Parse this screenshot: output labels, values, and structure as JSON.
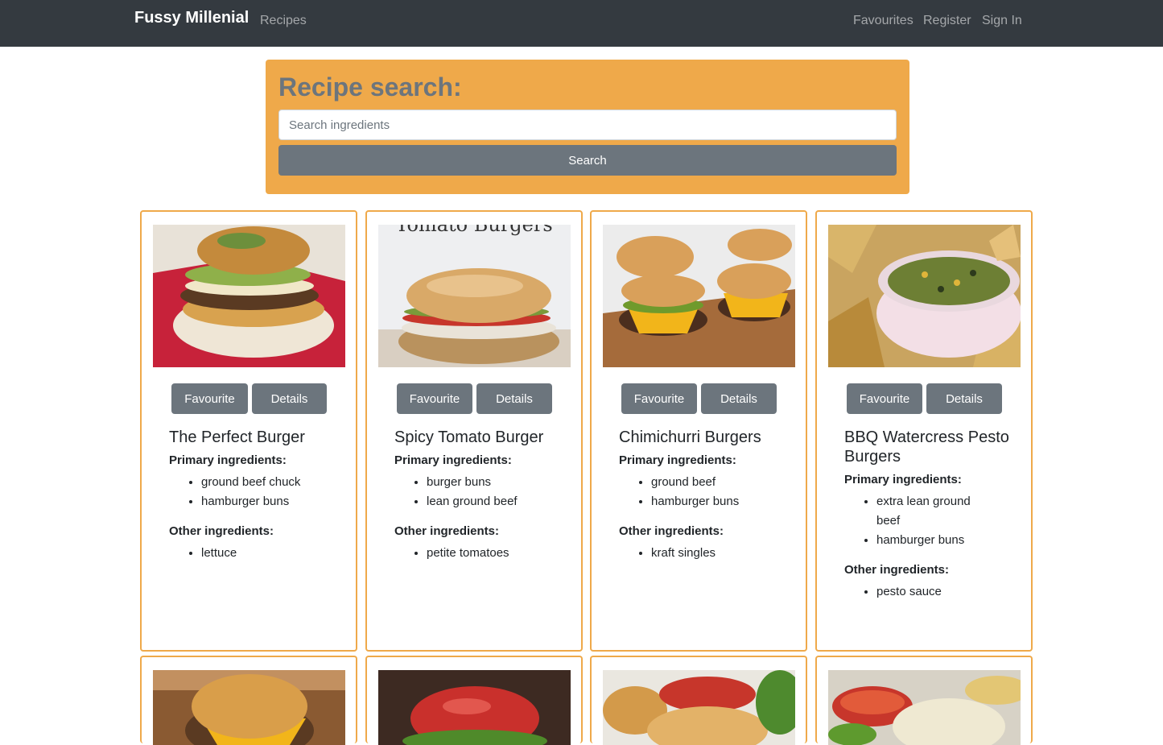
{
  "navbar": {
    "brand": "Fussy Millenial",
    "links_left": [
      "Recipes"
    ],
    "links_right": [
      "Favourites",
      "Register",
      "Sign In"
    ]
  },
  "search": {
    "title": "Recipe search:",
    "placeholder": "Search ingredients",
    "button_label": "Search"
  },
  "card_buttons": {
    "favourite": "Favourite",
    "details": "Details"
  },
  "labels": {
    "primary": "Primary ingredients:",
    "other": "Other ingredients:"
  },
  "recipes": [
    {
      "title": "The Perfect Burger",
      "primary": [
        "ground beef chuck",
        "hamburger buns"
      ],
      "other": [
        "lettuce"
      ]
    },
    {
      "title": "Spicy Tomato Burger",
      "image_caption": "Tomato Burgers",
      "primary": [
        "burger buns",
        "lean ground beef"
      ],
      "other": [
        "petite tomatoes"
      ]
    },
    {
      "title": "Chimichurri Burgers",
      "primary": [
        "ground beef",
        "hamburger buns"
      ],
      "other": [
        "kraft singles"
      ]
    },
    {
      "title": "BBQ Watercress Pesto Burgers",
      "primary": [
        "extra lean ground beef",
        "hamburger buns"
      ],
      "other": [
        "pesto sauce"
      ]
    }
  ],
  "colors": {
    "navbar": "#343a40",
    "accent": "#efa94a",
    "button": "#6c757d"
  }
}
